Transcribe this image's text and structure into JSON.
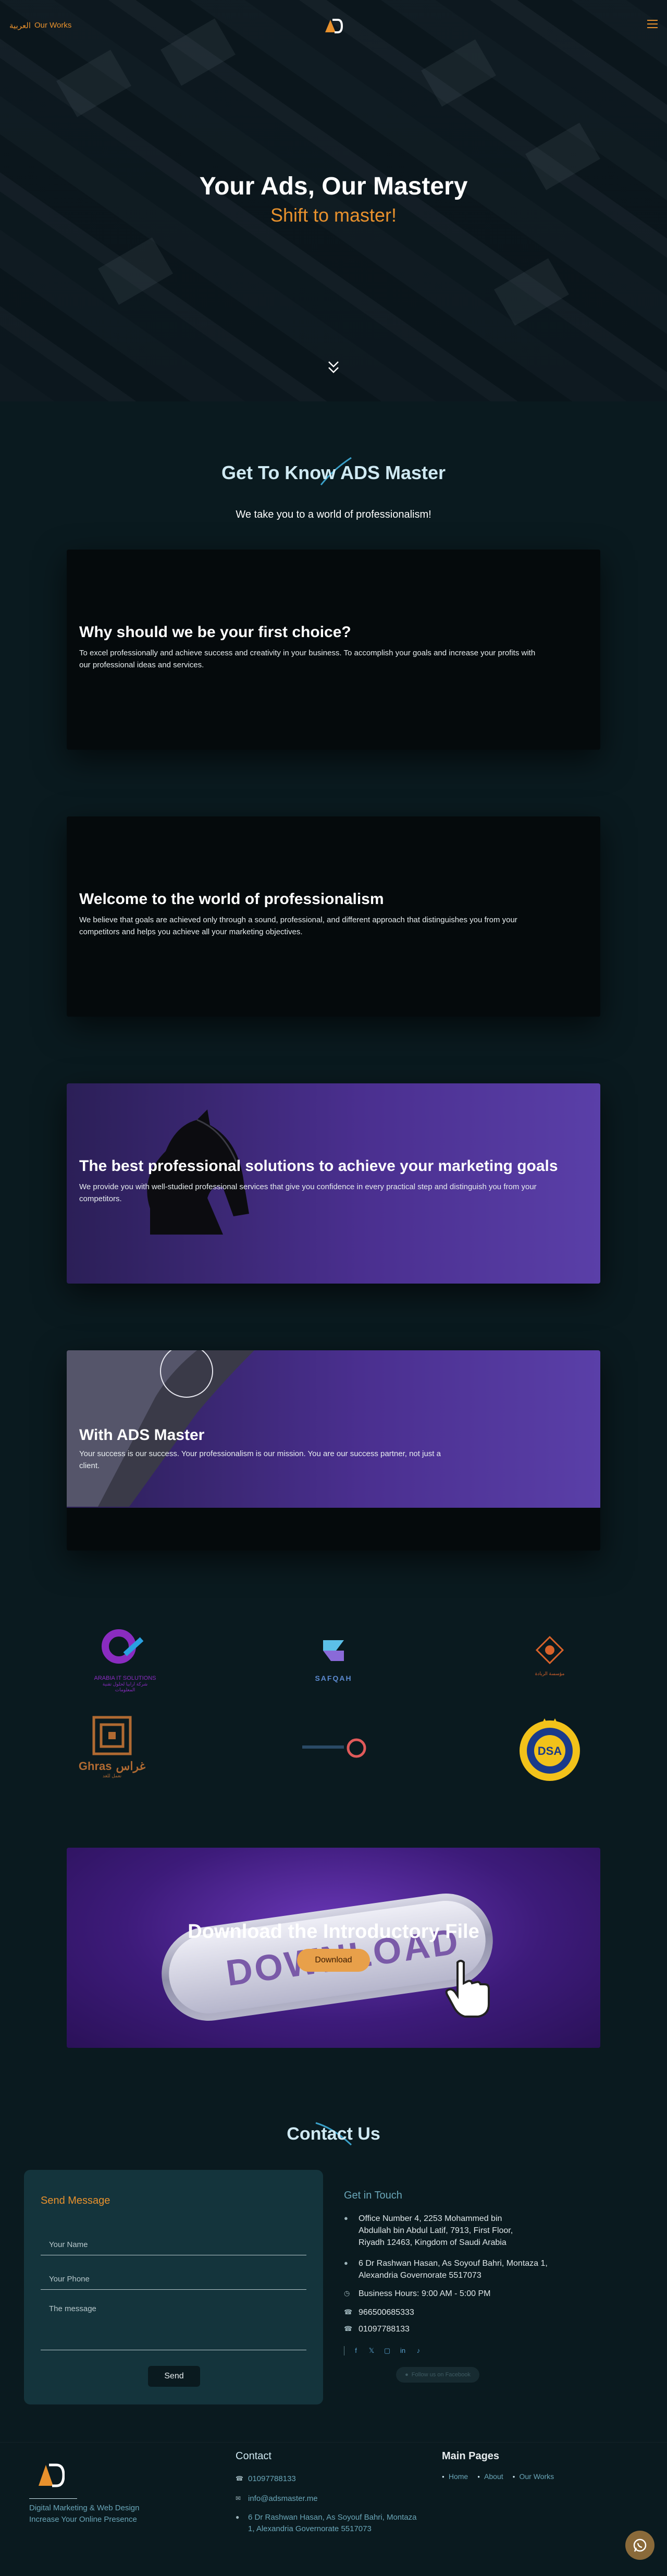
{
  "nav": {
    "lang_label": "العربية",
    "works_label": "Our Works"
  },
  "hero": {
    "title": "Your Ads, Our Mastery",
    "subtitle": "Shift to master!"
  },
  "about": {
    "title": "Get To Know ADS Master",
    "subtitle": "We take you to a world of professionalism!",
    "cards": [
      {
        "title": "Why should we be your first choice?",
        "text": "To excel professionally and achieve success and creativity in your business. To accomplish your goals and increase your profits with our professional ideas and services."
      },
      {
        "title": "Welcome to the world of professionalism",
        "text": "We believe that goals are achieved only through a sound, professional, and different approach that distinguishes you from your competitors and helps you achieve all your marketing objectives."
      },
      {
        "title": "The best professional solutions to achieve your marketing goals",
        "text": "We provide you with well-studied professional services that give you confidence in every practical step and distinguish you from your competitors."
      },
      {
        "title": "With ADS Master",
        "text": "Your success is our success. Your professionalism is our mission. You are our success partner, not just a client."
      }
    ]
  },
  "partners": {
    "arabia_name": "ARABIA IT SOLUTIONS",
    "arabia_tagline": "شركة ارابيا لحلول تقنية المعلومات",
    "safqah_name": "SAFQAH",
    "ghras_arabic": "غراس",
    "ghras_name": "Ghras",
    "ghras_tagline": "نعمل للغد",
    "emblem_caption": "مؤسسة الريادة"
  },
  "download": {
    "title": "Download the Introductory File",
    "pill_text": "DOWNLOAD",
    "button_label": "Download"
  },
  "contact": {
    "title": "Contact Us",
    "form": {
      "heading": "Send Message",
      "name_placeholder": "Your Name",
      "phone_placeholder": "Your Phone",
      "message_placeholder": "The message",
      "send_label": "Send"
    },
    "touch": {
      "heading": "Get in Touch",
      "address_sa": "Office Number 4, 2253 Mohammed bin Abdullah bin Abdul Latif, 7913, First Floor, Riyadh 12463, Kingdom of Saudi Arabia",
      "email": "info@adsmaster.me",
      "address_eg": "6 Dr Rashwan Hasan, As Soyouf Bahri, Montaza 1, Alexandria Governorate 5517073",
      "hours": "Business Hours: 9:00 AM - 5:00 PM",
      "phone_sa": "966500685333",
      "phone_eg": "01097788133",
      "follow_label": "Follow us on Facebook"
    }
  },
  "footer": {
    "tagline": "Digital Marketing & Web Design Increase Your Online Presence",
    "contact_title": "Contact",
    "phone": "01097788133",
    "email": "info@adsmaster.me",
    "address": "6 Dr Rashwan Hasan, As Soyouf Bahri, Montaza 1, Alexandria Governorate 5517073",
    "pages_title": "Main Pages",
    "pages": [
      "Home",
      "About",
      "Our Works"
    ]
  },
  "colors": {
    "accent": "#e8912d",
    "background": "#0a1a1f",
    "panel": "#14343c",
    "purple": "#4a2f8f"
  },
  "icons": [
    "ads-master-logo",
    "menu-icon",
    "chevron-down-icon",
    "location-pin-icon",
    "email-icon",
    "clock-icon",
    "phone-icon",
    "facebook-icon",
    "twitter-icon",
    "instagram-icon",
    "linkedin-icon",
    "tiktok-icon",
    "whatsapp-icon",
    "cursor-hand-icon"
  ]
}
